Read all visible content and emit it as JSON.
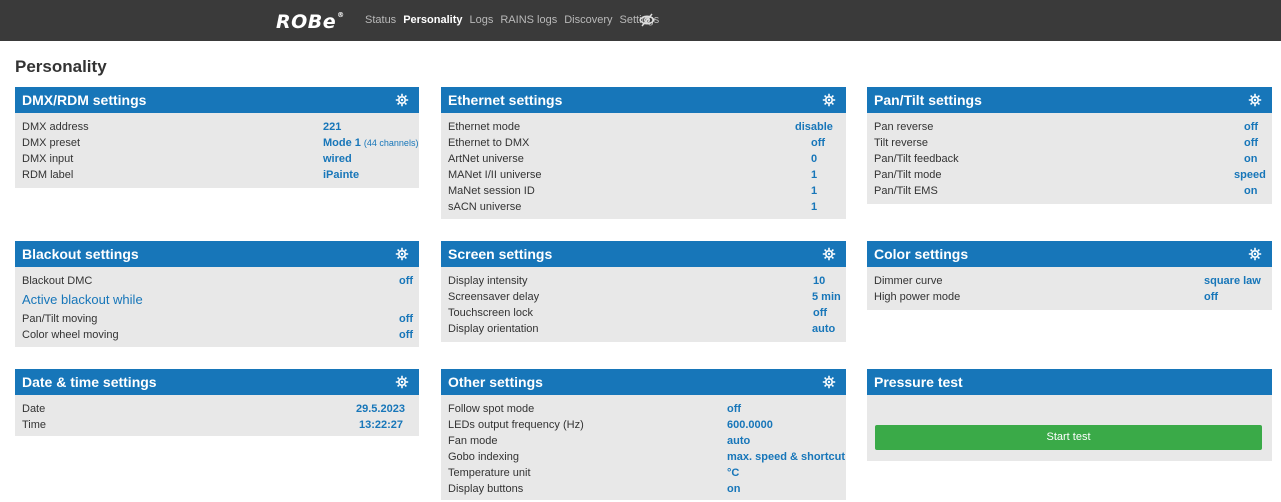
{
  "header": {
    "logo_text": "ROBe",
    "logo_mark": "®",
    "nav": [
      "Status",
      "Personality",
      "Logs",
      "RAINS logs",
      "Discovery",
      "Settings"
    ],
    "active": "Personality",
    "extra_icon": "eye-slash-icon"
  },
  "page_title": "Personality",
  "dmx": {
    "title": "DMX/RDM settings",
    "rows": [
      {
        "label": "DMX address",
        "value": "221"
      },
      {
        "label": "DMX preset",
        "value": "Mode 1",
        "note": "(44 channels)"
      },
      {
        "label": "DMX input",
        "value": "wired"
      },
      {
        "label": "RDM label",
        "value": "iPainte"
      }
    ]
  },
  "ethernet": {
    "title": "Ethernet settings",
    "rows": [
      {
        "label": "Ethernet mode",
        "value": "disable"
      },
      {
        "label": "Ethernet to DMX",
        "value": "off"
      },
      {
        "label": "ArtNet universe",
        "value": "0"
      },
      {
        "label": "MANet I/II universe",
        "value": "1"
      },
      {
        "label": "MaNet session ID",
        "value": "1"
      },
      {
        "label": "sACN universe",
        "value": "1"
      }
    ]
  },
  "pantilt": {
    "title": "Pan/Tilt settings",
    "rows": [
      {
        "label": "Pan reverse",
        "value": "off"
      },
      {
        "label": "Tilt reverse",
        "value": "off"
      },
      {
        "label": "Pan/Tilt feedback",
        "value": "on"
      },
      {
        "label": "Pan/Tilt mode",
        "value": "speed"
      },
      {
        "label": "Pan/Tilt EMS",
        "value": "on"
      }
    ]
  },
  "blackout": {
    "title": "Blackout settings",
    "dmc": {
      "label": "Blackout DMC",
      "value": "off"
    },
    "subheading": "Active blackout while",
    "rows": [
      {
        "label": "Pan/Tilt moving",
        "value": "off"
      },
      {
        "label": "Color wheel moving",
        "value": "off"
      }
    ]
  },
  "screen": {
    "title": "Screen settings",
    "rows": [
      {
        "label": "Display intensity",
        "value": "10"
      },
      {
        "label": "Screensaver delay",
        "value": "5 min"
      },
      {
        "label": "Touchscreen lock",
        "value": "off"
      },
      {
        "label": "Display orientation",
        "value": "auto"
      }
    ]
  },
  "color": {
    "title": "Color settings",
    "rows": [
      {
        "label": "Dimmer curve",
        "value": "square law"
      },
      {
        "label": "High power mode",
        "value": "off"
      }
    ]
  },
  "datetime": {
    "title": "Date & time settings",
    "rows": [
      {
        "label": "Date",
        "value": "29.5.2023"
      },
      {
        "label": "Time",
        "value": "13:22:27"
      }
    ]
  },
  "other": {
    "title": "Other settings",
    "rows": [
      {
        "label": "Follow spot mode",
        "value": "off"
      },
      {
        "label": "LEDs output frequency (Hz)",
        "value": "600.0000"
      },
      {
        "label": "Fan mode",
        "value": "auto"
      },
      {
        "label": "Gobo indexing",
        "value": "max. speed & shortcut"
      },
      {
        "label": "Temperature unit",
        "value": "°C"
      },
      {
        "label": "Display buttons",
        "value": "on"
      }
    ]
  },
  "pressure": {
    "title": "Pressure test",
    "button": "Start test"
  },
  "colors": {
    "header_bg": "#3a3a3a",
    "panel_head": "#1776b9",
    "panel_bg": "#e8e8e8",
    "value": "#1776b9",
    "button": "#3aaa48"
  }
}
